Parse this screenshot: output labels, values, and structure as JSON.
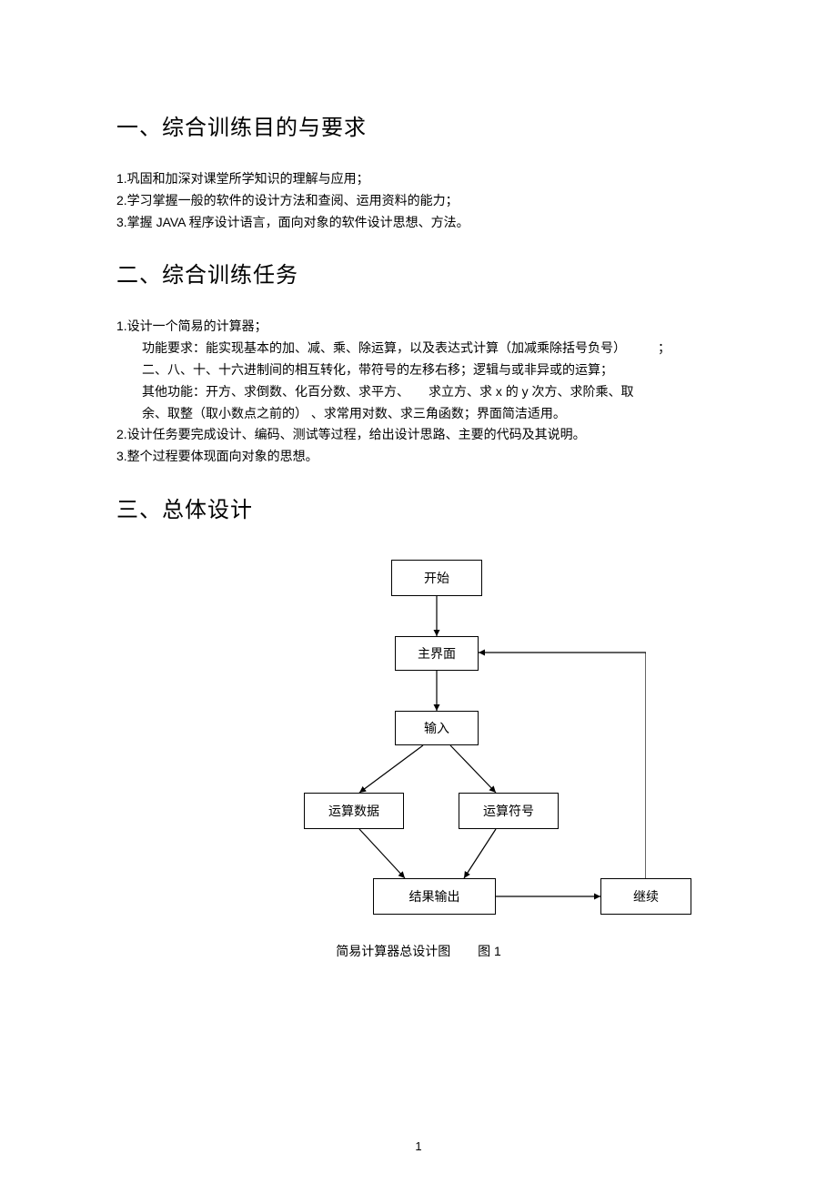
{
  "sections": {
    "s1_title": "一、综合训练目的与要求",
    "s1_items": [
      "1.巩固和加深对课堂所学知识的理解与应用；",
      "2.学习掌握一般的软件的设计方法和查阅、运用资料的能力；",
      "3.掌握 JAVA 程序设计语言，面向对象的软件设计思想、方法。"
    ],
    "s2_title": "二、综合训练任务",
    "s2_lines": [
      {
        "text": "1.设计一个简易的计算器；",
        "indent": false
      },
      {
        "text": "功能要求：能实现基本的加、减、乘、除运算，以及表达式计算（加减乘除括号负号）　　　；",
        "indent": true
      },
      {
        "text": "二、八、十、十六进制间的相互转化，带符号的左移右移；逻辑与或非异或的运算；",
        "indent": true
      },
      {
        "text": "其他功能：开方、求倒数、化百分数、求平方、　　求立方、求  x 的  y 次方、求阶乘、取",
        "indent": true
      },
      {
        "text": "余、取整（取小数点之前的）  、求常用对数、求三角函数；界面简洁适用。",
        "indent": true
      },
      {
        "text": "2.设计任务要完成设计、编码、测试等过程，给出设计思路、主要的代码及其说明。",
        "indent": false
      },
      {
        "text": "3.整个过程要体现面向对象的思想。",
        "indent": false
      }
    ],
    "s3_title": "三、总体设计"
  },
  "flowchart": {
    "nodes": {
      "start": "开始",
      "main_ui": "主界面",
      "input": "输入",
      "data": "运算数据",
      "op": "运算符号",
      "result": "结果输出",
      "continue": "继续"
    },
    "caption_text": "简易计算器总设计图",
    "caption_fig": "图 1"
  },
  "page_number": "1"
}
